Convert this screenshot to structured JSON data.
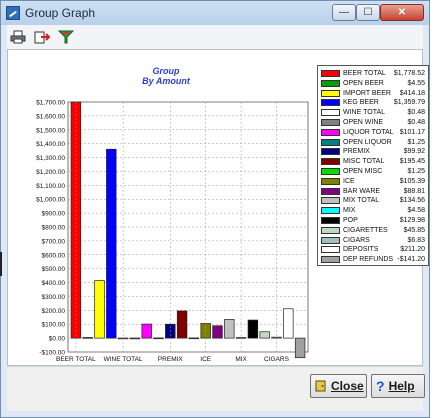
{
  "window": {
    "title": "Group Graph",
    "minimize_glyph": "—",
    "maximize_glyph": "☐",
    "close_glyph": "✕"
  },
  "toolbar": {
    "buttons": [
      {
        "name": "print-icon"
      },
      {
        "name": "export-icon"
      },
      {
        "name": "filter-icon"
      }
    ]
  },
  "footer": {
    "close_label": "Close",
    "help_label": "Help"
  },
  "colors": {
    "accent": "#2f6fb5",
    "chart_title": "#2a3fc9"
  },
  "chart_data": {
    "type": "bar",
    "title": "Group",
    "subtitle": "By Amount",
    "xlabel": "",
    "ylabel": "",
    "ylim": [
      -100,
      1700
    ],
    "ytick_step": 100,
    "ytick_labels": [
      "-$100.00",
      "$0.00",
      "$100.00",
      "$200.00",
      "$300.00",
      "$400.00",
      "$500.00",
      "$600.00",
      "$700.00",
      "$800.00",
      "$900.00",
      "$1,000.00",
      "$1,100.00",
      "$1,200.00",
      "$1,300.00",
      "$1,400.00",
      "$1,500.00",
      "$1,600.00",
      "$1,700.00"
    ],
    "grid": true,
    "legend_position": "top-right",
    "x_tick_labels": [
      "BEER TOTAL",
      "WINE TOTAL",
      "PREMIX",
      "ICE",
      "MIX",
      "CIGARS"
    ],
    "categories": [
      "BEER TOTAL",
      "OPEN BEER",
      "IMPORT BEER",
      "KEG BEER",
      "WINE TOTAL",
      "OPEN WINE",
      "LIQUOR TOTAL",
      "OPEN LIQUOR",
      "PREMIX",
      "MISC TOTAL",
      "OPEN MISC",
      "ICE",
      "BAR WARE",
      "MIX TOTAL",
      "MIX",
      "POP",
      "CIGARETTES",
      "CIGARS",
      "DEPOSITS",
      "DEP REFUNDS"
    ],
    "values": [
      1778.52,
      4.55,
      414.18,
      1359.79,
      0.48,
      0.48,
      101.17,
      1.25,
      99.92,
      195.45,
      1.25,
      105.39,
      88.81,
      134.56,
      4.58,
      129.98,
      45.85,
      6.83,
      211.2,
      -141.2
    ],
    "value_labels": [
      "$1,778.52",
      "$4.55",
      "$414.18",
      "$1,359.79",
      "$0.48",
      "$0.48",
      "$101.17",
      "$1.25",
      "$99.92",
      "$195.45",
      "$1.25",
      "$105.39",
      "$88.81",
      "$134.56",
      "$4.58",
      "$129.98",
      "$45.85",
      "$6.83",
      "$211.20",
      "-$141.20"
    ],
    "colors": [
      "#ff0000",
      "#00a000",
      "#ffff00",
      "#0000ff",
      "#ffffff",
      "#808080",
      "#ff00ff",
      "#008080",
      "#000080",
      "#800000",
      "#00e000",
      "#808000",
      "#800080",
      "#c0c0c0",
      "#00ffff",
      "#000000",
      "#c0d8c0",
      "#a0c0c0",
      "#ffffff",
      "#a0a0a0"
    ]
  }
}
